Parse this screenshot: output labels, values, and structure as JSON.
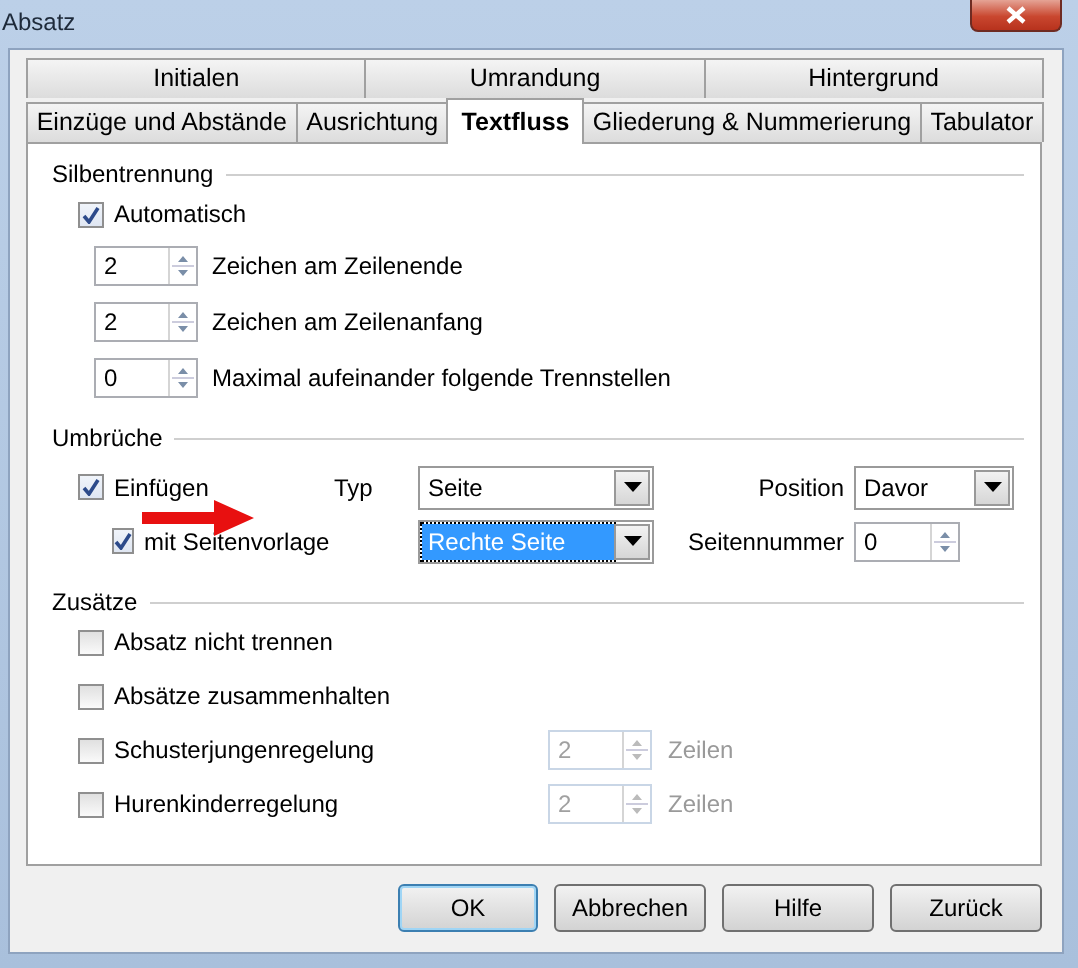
{
  "window": {
    "title": "Absatz"
  },
  "tab_rows": [
    {
      "tabs": [
        {
          "label": "Initialen",
          "selected": false
        },
        {
          "label": "Umrandung",
          "selected": false
        },
        {
          "label": "Hintergrund",
          "selected": false
        }
      ]
    },
    {
      "tabs": [
        {
          "label": "Einzüge und Abstände",
          "selected": false
        },
        {
          "label": "Ausrichtung",
          "selected": false
        },
        {
          "label": "Textfluss",
          "selected": true
        },
        {
          "label": "Gliederung & Nummerierung",
          "selected": false
        },
        {
          "label": "Tabulator",
          "selected": false
        }
      ]
    }
  ],
  "hyphenation": {
    "title": "Silbentrennung",
    "automatic": {
      "label": "Automatisch",
      "checked": true
    },
    "spinners": [
      {
        "value": "2",
        "label": "Zeichen am Zeilenende"
      },
      {
        "value": "2",
        "label": "Zeichen am Zeilenanfang"
      },
      {
        "value": "0",
        "label": "Maximal aufeinander folgende Trennstellen"
      }
    ]
  },
  "breaks": {
    "title": "Umbrüche",
    "insert": {
      "label": "Einfügen",
      "checked": true
    },
    "type": {
      "label": "Typ",
      "value": "Seite"
    },
    "position": {
      "label": "Position",
      "value": "Davor"
    },
    "with_page_style": {
      "label": "mit Seitenvorlage",
      "checked": true
    },
    "page_style": {
      "value": "Rechte Seite",
      "selected": true
    },
    "page_number": {
      "label": "Seitennummer",
      "value": "0"
    }
  },
  "options": {
    "title": "Zusätze",
    "items": [
      {
        "kind": "check",
        "label": "Absatz nicht trennen",
        "checked": false
      },
      {
        "kind": "check",
        "label": "Absätze zusammenhalten",
        "checked": false
      },
      {
        "kind": "check-spin",
        "label": "Schusterjungenregelung",
        "checked": false,
        "spin": {
          "value": "2",
          "disabled": true
        },
        "unit": "Zeilen"
      },
      {
        "kind": "check-spin",
        "label": "Hurenkinderregelung",
        "checked": false,
        "spin": {
          "value": "2",
          "disabled": true
        },
        "unit": "Zeilen"
      }
    ]
  },
  "buttons": [
    {
      "label": "OK",
      "default": true
    },
    {
      "label": "Abbrechen",
      "default": false
    },
    {
      "label": "Hilfe",
      "default": false
    },
    {
      "label": "Zurück",
      "default": false
    }
  ]
}
